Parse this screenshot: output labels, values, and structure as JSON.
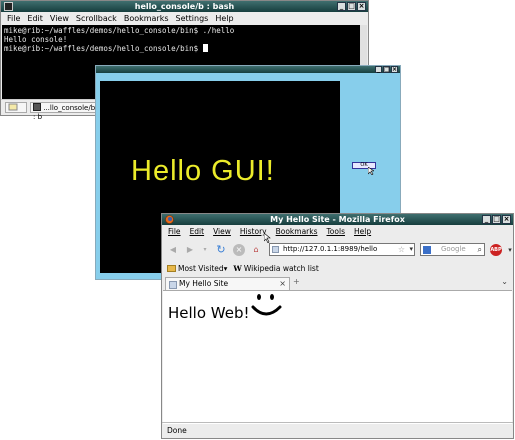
{
  "terminal": {
    "title": "hello_console/b : bash",
    "menu": [
      "File",
      "Edit",
      "View",
      "Scrollback",
      "Bookmarks",
      "Settings",
      "Help"
    ],
    "lines": [
      "mike@rib:~/waffles/demos/hello_console/bin$ ./hello",
      "Hello console!",
      "mike@rib:~/waffles/demos/hello_console/bin$ "
    ],
    "taskbar_tab": "...llo_console/b : b"
  },
  "gui": {
    "greeting": "Hello GUI!",
    "button_label": "OK"
  },
  "firefox": {
    "title": "My Hello Site - Mozilla Firefox",
    "menu": [
      "File",
      "Edit",
      "View",
      "History",
      "Bookmarks",
      "Tools",
      "Help"
    ],
    "url": "http://127.0.1.1:8989/hello",
    "search_placeholder": "Google",
    "bookmarks": [
      "Most Visited",
      "Wikipedia watch list"
    ],
    "tab_title": "My Hello Site",
    "page_text": "Hello Web!",
    "status": "Done",
    "adblock_label": "ABP"
  },
  "colors": {
    "titlebar": "#163e3e",
    "gui_background": "#87ceeb",
    "gui_text": "#ecec2a"
  }
}
